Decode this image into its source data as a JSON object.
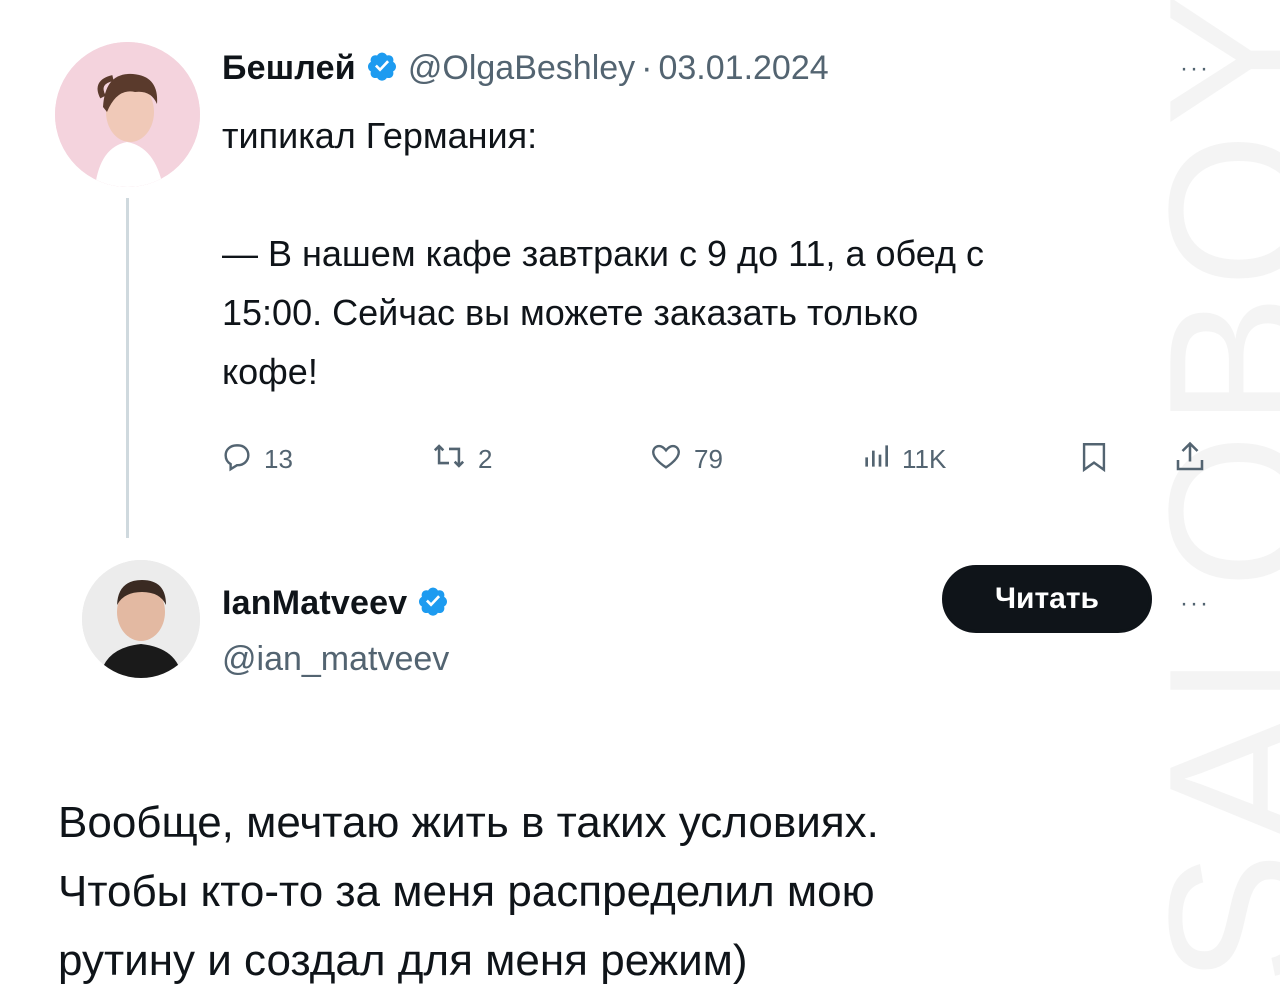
{
  "watermark": "SALOBOY",
  "tweet1": {
    "author_name": "Бешлей",
    "handle": "@OlgaBeshley",
    "separator": "·",
    "date": "03.01.2024",
    "more": "···",
    "text_line1": "типикал Германия:",
    "text_line2": "— В нашем кафе завтраки с 9 до 11, а обед с",
    "text_line3": "15:00. Сейчас вы можете заказать только",
    "text_line4": "кофе!",
    "replies": "13",
    "reposts": "2",
    "likes": "79",
    "views": "11K"
  },
  "tweet2": {
    "author_name": "IanMatveev",
    "handle": "@ian_matveev",
    "follow_label": "Читать",
    "more": "···",
    "text_line1": "Вообще, мечтаю жить в таких условиях.",
    "text_line2": "Чтобы кто-то за меня распределил мою",
    "text_line3": "рутину и создал для меня режим)"
  },
  "colors": {
    "verified": "#1d9bf0",
    "text": "#0f1419",
    "secondary": "#536471",
    "thread_line": "#cfd9de"
  },
  "icons": [
    "reply-icon",
    "repost-icon",
    "like-icon",
    "views-icon",
    "bookmark-icon",
    "share-icon",
    "verified-icon",
    "more-icon"
  ]
}
